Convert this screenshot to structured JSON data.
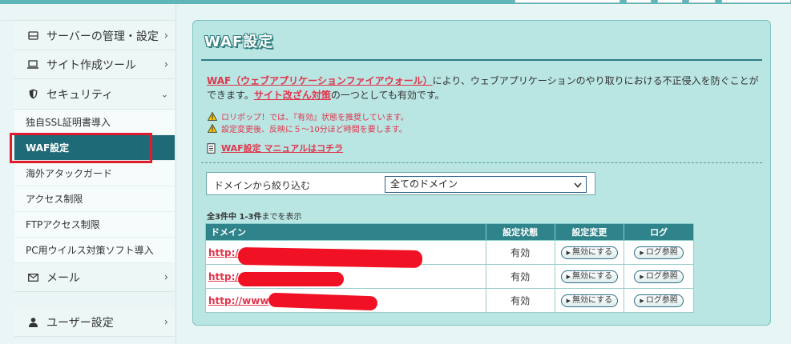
{
  "sidebar": {
    "items": [
      {
        "label": "サーバーの管理・設定",
        "icon": "server-icon"
      },
      {
        "label": "サイト作成ツール",
        "icon": "laptop-icon"
      },
      {
        "label": "セキュリティ",
        "icon": "shield-icon"
      }
    ],
    "security_sub": [
      "独自SSL証明書導入",
      "WAF設定",
      "海外アタックガード",
      "アクセス制限",
      "FTPアクセス制限",
      "PC用ウイルス対策ソフト導入"
    ],
    "mail": {
      "label": "メール",
      "icon": "mail-icon"
    },
    "user": {
      "label": "ユーザー設定",
      "icon": "user-icon"
    }
  },
  "panel": {
    "title": "WAF設定",
    "desc_link1": "WAF（ウェブアプリケーションファイアウォール）",
    "desc_text1": "により、ウェブアプリケーションのやり取りにおける不正侵入を防ぐことができます。",
    "desc_link2": "サイト改ざん対策",
    "desc_text2": "の一つとしても有効です。",
    "warnings": [
      "ロリポップ！では、『有効』状態を推奨しています。",
      "設定変更後、反映に５〜10分ほど時間を要します。"
    ],
    "manual_link": "WAF設定 マニュアルはコチラ"
  },
  "filter": {
    "label": "ドメインから絞り込む",
    "selected": "全てのドメイン"
  },
  "count": {
    "prefix": "全3件中 1-3件",
    "suffix": "までを表示"
  },
  "table": {
    "headers": [
      "ドメイン",
      "設定状態",
      "設定変更",
      "ログ"
    ],
    "rows": [
      {
        "domain": "http://",
        "status": "有効",
        "change": "無効にする",
        "log": "ログ参照"
      },
      {
        "domain": "http://",
        "status": "有効",
        "change": "無効にする",
        "log": "ログ参照"
      },
      {
        "domain": "http://www",
        "status": "有効",
        "change": "無効にする",
        "log": "ログ参照"
      }
    ]
  },
  "colors": {
    "accent": "#2f838a",
    "link": "#e0354b",
    "active_nav": "#1f6a77",
    "highlight": "#e01b2c"
  }
}
